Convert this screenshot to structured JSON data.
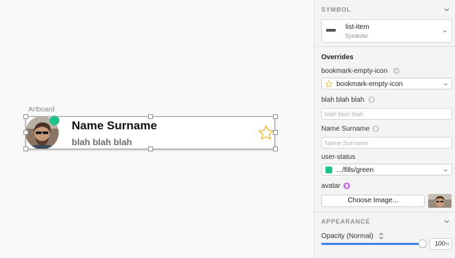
{
  "canvas": {
    "artboard_label": "Artboard",
    "card": {
      "name": "Name Surname",
      "subtitle": "blah blah blah",
      "status_color": "#1ec487",
      "star_icon": "bookmark-empty-icon"
    }
  },
  "inspector": {
    "symbol": {
      "section_title": "SYMBOL",
      "name": "list-item",
      "path": "Symbols/"
    },
    "overrides": {
      "heading": "Overrides",
      "bookmark": {
        "label": "bookmark-empty-icon",
        "value": "bookmark-empty-icon"
      },
      "blah": {
        "label": "blah blah blah",
        "placeholder": "blah blah blah"
      },
      "name": {
        "label": "Name Surname",
        "placeholder": "Name Surname"
      },
      "status": {
        "label": "user-status",
        "value": ".../fills/green",
        "color": "#1ec487"
      },
      "avatar": {
        "label": "avatar",
        "button": "Choose Image..."
      }
    },
    "appearance": {
      "section_title": "APPEARANCE",
      "opacity_label": "Opacity (Normal)",
      "opacity_value": "100",
      "opacity_unit": "%",
      "accent": "#3f7fe8"
    }
  }
}
